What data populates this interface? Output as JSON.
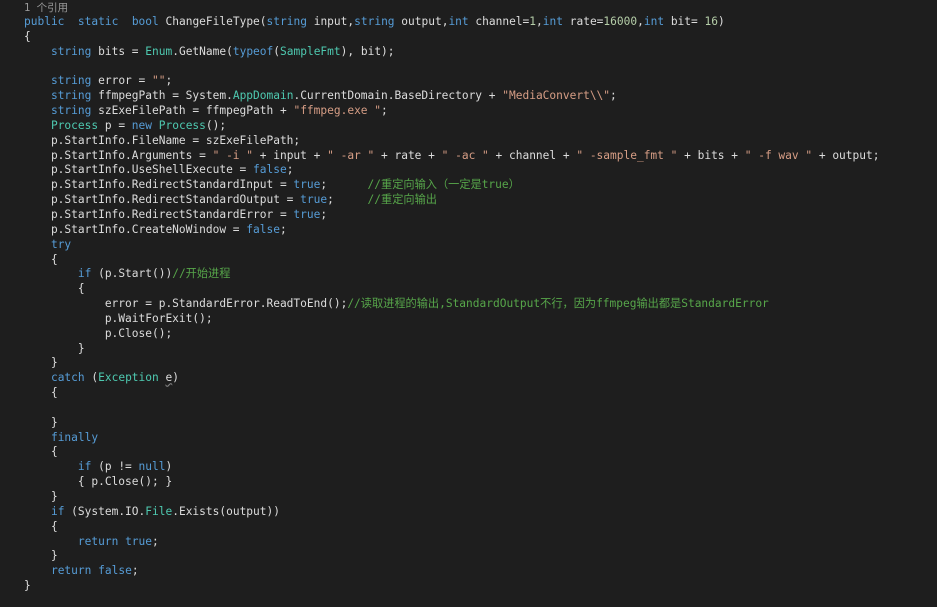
{
  "codelens": "1 个引用",
  "lines": [
    [
      [
        "kw",
        "public"
      ],
      [
        "",
        "  "
      ],
      [
        "kw",
        "static"
      ],
      [
        "",
        "  "
      ],
      [
        "kw",
        "bool"
      ],
      [
        "",
        " ChangeFileType("
      ],
      [
        "kw",
        "string"
      ],
      [
        "",
        " input,"
      ],
      [
        "kw",
        "string"
      ],
      [
        "",
        " output,"
      ],
      [
        "kw",
        "int"
      ],
      [
        "",
        " channel="
      ],
      [
        "nm",
        "1"
      ],
      [
        "",
        ","
      ],
      [
        "kw",
        "int"
      ],
      [
        "",
        " rate="
      ],
      [
        "nm",
        "16000"
      ],
      [
        "",
        ","
      ],
      [
        "kw",
        "int"
      ],
      [
        "",
        " bit= "
      ],
      [
        "nm",
        "16"
      ],
      [
        "",
        ")"
      ]
    ],
    [
      [
        "",
        "{"
      ]
    ],
    [
      [
        "",
        "    "
      ],
      [
        "kw",
        "string"
      ],
      [
        "",
        " bits = "
      ],
      [
        "ty",
        "Enum"
      ],
      [
        "",
        ".GetName("
      ],
      [
        "kw",
        "typeof"
      ],
      [
        "",
        "("
      ],
      [
        "ty",
        "SampleFmt"
      ],
      [
        "",
        "), bit);"
      ]
    ],
    [
      [
        "",
        ""
      ]
    ],
    [
      [
        "",
        "    "
      ],
      [
        "kw",
        "string"
      ],
      [
        "",
        " error = "
      ],
      [
        "st",
        "\"\""
      ],
      [
        "",
        ";"
      ]
    ],
    [
      [
        "",
        "    "
      ],
      [
        "kw",
        "string"
      ],
      [
        "",
        " ffmpegPath = System."
      ],
      [
        "ty",
        "AppDomain"
      ],
      [
        "",
        ".CurrentDomain.BaseDirectory + "
      ],
      [
        "st",
        "\"MediaConvert\\\\\""
      ],
      [
        "",
        ";"
      ]
    ],
    [
      [
        "",
        "    "
      ],
      [
        "kw",
        "string"
      ],
      [
        "",
        " szExeFilePath = ffmpegPath + "
      ],
      [
        "st",
        "\"ffmpeg.exe \""
      ],
      [
        "",
        ";"
      ]
    ],
    [
      [
        "",
        "    "
      ],
      [
        "ty",
        "Process"
      ],
      [
        "",
        " p = "
      ],
      [
        "kw",
        "new"
      ],
      [
        "",
        ""
      ],
      [
        "ty",
        " Process"
      ],
      [
        "",
        "();"
      ]
    ],
    [
      [
        "",
        "    p.StartInfo.FileName = szExeFilePath;"
      ]
    ],
    [
      [
        "",
        "    p.StartInfo.Arguments = "
      ],
      [
        "st",
        "\" -i \""
      ],
      [
        "",
        " + input + "
      ],
      [
        "st",
        "\" -ar \""
      ],
      [
        "",
        " + rate + "
      ],
      [
        "st",
        "\" -ac \""
      ],
      [
        "",
        " + channel + "
      ],
      [
        "st",
        "\" -sample_fmt \""
      ],
      [
        "",
        " + bits + "
      ],
      [
        "st",
        "\" -f wav \""
      ],
      [
        "",
        " + output;"
      ]
    ],
    [
      [
        "",
        "    p.StartInfo.UseShellExecute = "
      ],
      [
        "kw",
        "false"
      ],
      [
        "",
        ";"
      ]
    ],
    [
      [
        "",
        "    p.StartInfo.RedirectStandardInput = "
      ],
      [
        "kw",
        "true"
      ],
      [
        "",
        ";      "
      ],
      [
        "cm",
        "//重定向输入（一定是true）"
      ]
    ],
    [
      [
        "",
        "    p.StartInfo.RedirectStandardOutput = "
      ],
      [
        "kw",
        "true"
      ],
      [
        "",
        ";     "
      ],
      [
        "cm",
        "//重定向输出"
      ]
    ],
    [
      [
        "",
        "    p.StartInfo.RedirectStandardError = "
      ],
      [
        "kw",
        "true"
      ],
      [
        "",
        ";"
      ]
    ],
    [
      [
        "",
        "    p.StartInfo.CreateNoWindow = "
      ],
      [
        "kw",
        "false"
      ],
      [
        "",
        ";"
      ]
    ],
    [
      [
        "",
        "    "
      ],
      [
        "kw",
        "try"
      ]
    ],
    [
      [
        "",
        "    {"
      ]
    ],
    [
      [
        "",
        "        "
      ],
      [
        "kw",
        "if"
      ],
      [
        "",
        " (p.Start())"
      ],
      [
        "cm",
        "//开始进程"
      ]
    ],
    [
      [
        "",
        "        {"
      ]
    ],
    [
      [
        "",
        "            error = p.StandardError.ReadToEnd();"
      ],
      [
        "cm",
        "//读取进程的输出,StandardOutput不行，因为ffmpeg输出都是StandardError"
      ]
    ],
    [
      [
        "",
        "            p.WaitForExit();"
      ]
    ],
    [
      [
        "",
        "            p.Close();"
      ]
    ],
    [
      [
        "",
        "        }"
      ]
    ],
    [
      [
        "",
        "    }"
      ]
    ],
    [
      [
        "",
        "    "
      ],
      [
        "kw",
        "catch"
      ],
      [
        "",
        " ("
      ],
      [
        "ty",
        "Exception"
      ],
      [
        "",
        " "
      ],
      [
        "squig",
        "e"
      ],
      [
        "",
        ")"
      ]
    ],
    [
      [
        "",
        "    {"
      ]
    ],
    [
      [
        "",
        ""
      ]
    ],
    [
      [
        "",
        "    }"
      ]
    ],
    [
      [
        "",
        "    "
      ],
      [
        "kw",
        "finally"
      ]
    ],
    [
      [
        "",
        "    {"
      ]
    ],
    [
      [
        "",
        "        "
      ],
      [
        "kw",
        "if"
      ],
      [
        "",
        " (p != "
      ],
      [
        "kw",
        "null"
      ],
      [
        "",
        ")"
      ]
    ],
    [
      [
        "",
        "        { p.Close(); }"
      ]
    ],
    [
      [
        "",
        "    }"
      ]
    ],
    [
      [
        "",
        "    "
      ],
      [
        "kw",
        "if"
      ],
      [
        "",
        " (System.IO."
      ],
      [
        "ty",
        "File"
      ],
      [
        "",
        ".Exists(output))"
      ]
    ],
    [
      [
        "",
        "    {"
      ]
    ],
    [
      [
        "",
        "        "
      ],
      [
        "kw",
        "return"
      ],
      [
        "",
        " "
      ],
      [
        "kw",
        "true"
      ],
      [
        "",
        ";"
      ]
    ],
    [
      [
        "",
        "    }"
      ]
    ],
    [
      [
        "",
        "    "
      ],
      [
        "kw",
        "return"
      ],
      [
        "",
        " "
      ],
      [
        "kw",
        "false"
      ],
      [
        "",
        ";"
      ]
    ],
    [
      [
        "",
        "}"
      ]
    ]
  ]
}
